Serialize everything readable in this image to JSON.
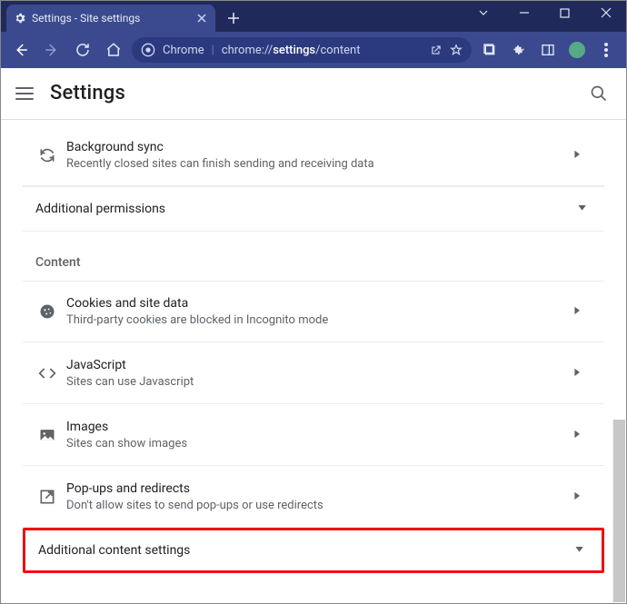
{
  "window": {
    "tab_title": "Settings - Site settings"
  },
  "addressbar": {
    "site_label": "Chrome",
    "url_prefix": "chrome://",
    "url_bold": "settings",
    "url_suffix": "/content"
  },
  "header": {
    "title": "Settings"
  },
  "rows": {
    "bgsync_title": "Background sync",
    "bgsync_sub": "Recently closed sites can finish sending and receiving data",
    "add_perm": "Additional permissions",
    "content_label": "Content",
    "cookies_title": "Cookies and site data",
    "cookies_sub": "Third-party cookies are blocked in Incognito mode",
    "js_title": "JavaScript",
    "js_sub": "Sites can use Javascript",
    "images_title": "Images",
    "images_sub": "Sites can show images",
    "popups_title": "Pop-ups and redirects",
    "popups_sub": "Don't allow sites to send pop-ups or use redirects",
    "add_content": "Additional content settings"
  }
}
